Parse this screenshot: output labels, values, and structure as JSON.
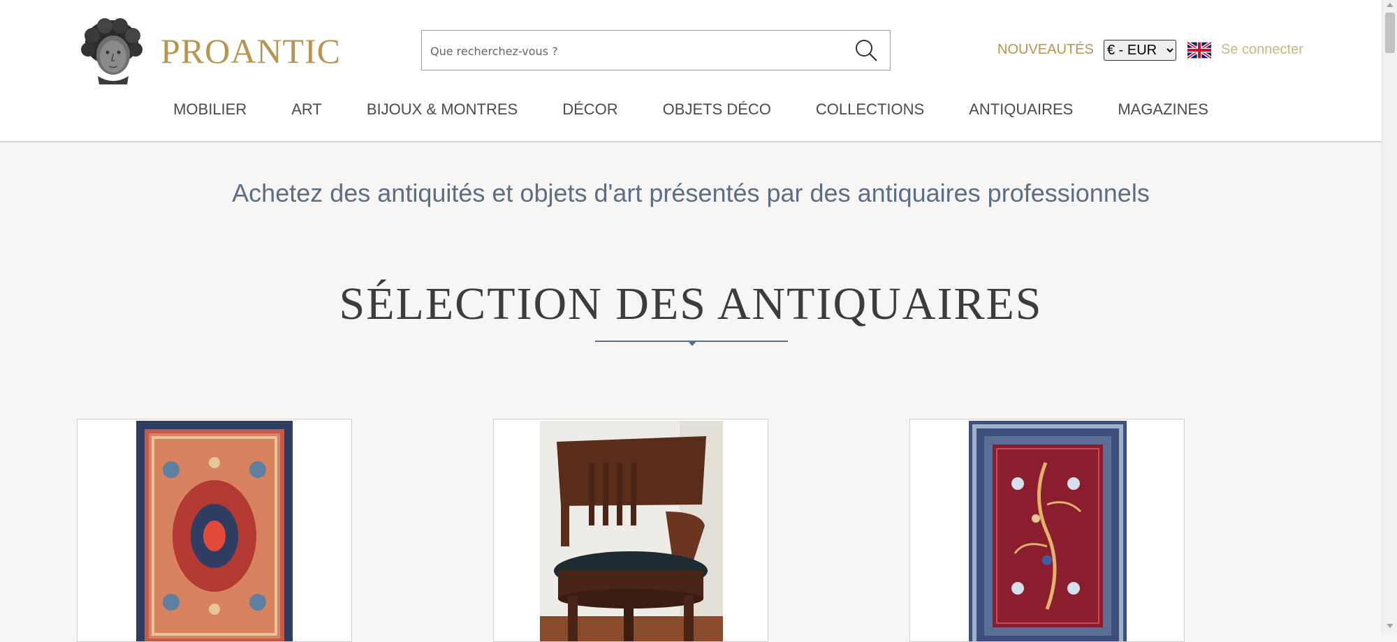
{
  "header": {
    "logo_text": "PROANTIC",
    "search": {
      "placeholder": "Que recherchez-vous ?"
    },
    "nouveautes_label": "NOUVEAUTÉS",
    "currency": {
      "selected": "€ - EUR"
    },
    "language_flag": "uk-flag-icon",
    "login_label": "Se connecter"
  },
  "nav": {
    "items": [
      {
        "label": "MOBILIER"
      },
      {
        "label": "ART"
      },
      {
        "label": "BIJOUX & MONTRES"
      },
      {
        "label": "DÉCOR"
      },
      {
        "label": "OBJETS DÉCO"
      },
      {
        "label": "COLLECTIONS"
      },
      {
        "label": "ANTIQUAIRES"
      },
      {
        "label": "MAGAZINES"
      }
    ]
  },
  "main": {
    "tagline": "Achetez des antiquités et objets d'art présentés par des antiquaires professionnels",
    "section_title": "SÉLECTION DES ANTIQUAIRES",
    "products": [
      {
        "image": "persian-rug-red-medallion"
      },
      {
        "image": "empire-mahogany-armchair"
      },
      {
        "image": "persian-rug-burgundy-pictorial"
      }
    ]
  },
  "colors": {
    "gold": "#b8944d",
    "light_gold": "#cdb583",
    "slate_blue": "#5a6e84",
    "background": "#f7f6f4"
  }
}
